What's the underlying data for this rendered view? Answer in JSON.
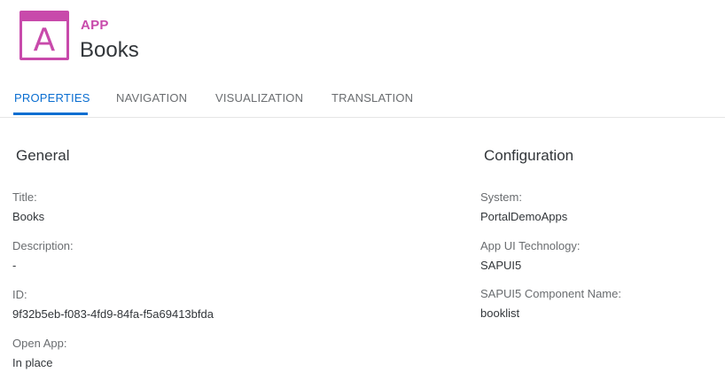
{
  "header": {
    "icon_letter": "A",
    "type_label": "APP",
    "title": "Books",
    "accent_color": "#c84aab"
  },
  "tabs": [
    {
      "label": "PROPERTIES",
      "active": true
    },
    {
      "label": "NAVIGATION",
      "active": false
    },
    {
      "label": "VISUALIZATION",
      "active": false
    },
    {
      "label": "TRANSLATION",
      "active": false
    }
  ],
  "general": {
    "title": "General",
    "fields": [
      {
        "label": "Title:",
        "value": "Books"
      },
      {
        "label": "Description:",
        "value": "-"
      },
      {
        "label": "ID:",
        "value": "9f32b5eb-f083-4fd9-84fa-f5a69413bfda"
      },
      {
        "label": "Open App:",
        "value": "In place"
      }
    ]
  },
  "configuration": {
    "title": "Configuration",
    "fields": [
      {
        "label": "System:",
        "value": "PortalDemoApps"
      },
      {
        "label": "App UI Technology:",
        "value": "SAPUI5"
      },
      {
        "label": "SAPUI5 Component Name:",
        "value": "booklist"
      }
    ]
  },
  "colors": {
    "active_tab": "#0a6ed1",
    "text": "#32363a",
    "label": "#6a6d70"
  }
}
